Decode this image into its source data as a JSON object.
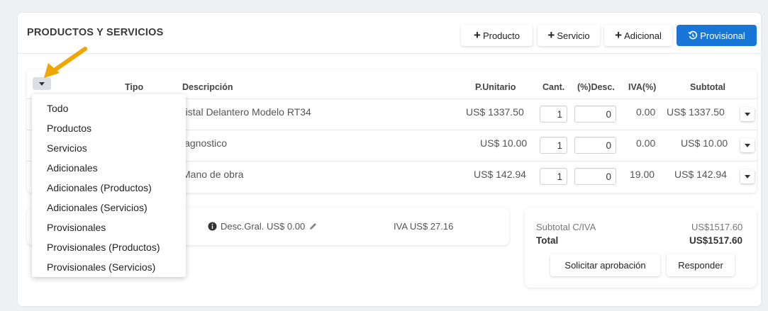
{
  "header": {
    "title": "PRODUCTOS Y SERVICIOS",
    "buttons": {
      "producto": "Producto",
      "servicio": "Servicio",
      "adicional": "Adicional",
      "provisional": "Provisional"
    }
  },
  "table": {
    "columns": {
      "tipo": "Tipo",
      "descripcion": "Descripción",
      "unitario": "P.Unitario",
      "cant": "Cant.",
      "desc": "(%)Desc.",
      "iva": "IVA(%)",
      "subtotal": "Subtotal"
    },
    "rows": [
      {
        "descripcion": "ristal Delantero Modelo RT34",
        "unitario": "US$ 1337.50",
        "cant": "1",
        "desc": "0",
        "iva": "0.00",
        "subtotal": "US$ 1337.50"
      },
      {
        "descripcion": "iagnostico",
        "unitario": "US$ 10.00",
        "cant": "1",
        "desc": "0",
        "iva": "0.00",
        "subtotal": "US$ 10.00"
      },
      {
        "descripcion": "Mano de obra",
        "unitario": "US$ 142.94",
        "cant": "1",
        "desc": "0",
        "iva": "19.00",
        "subtotal": "US$ 142.94"
      }
    ]
  },
  "summary": {
    "desc_general": "Desc.Gral. US$ 0.00",
    "iva": "IVA US$ 27.16"
  },
  "totals": {
    "subtotal_label": "Subtotal C/IVA",
    "subtotal_value": "US$1517.60",
    "total_label": "Total",
    "total_value": "US$1517.60",
    "solicitar": "Solicitar aprobación",
    "responder": "Responder"
  },
  "filter_menu": {
    "items": [
      "Todo",
      "Productos",
      "Servicios",
      "Adicionales",
      "Adicionales (Productos)",
      "Adicionales (Servicios)",
      "Provisionales",
      "Provisionales (Productos)",
      "Provisionales (Servicios)"
    ]
  },
  "colors": {
    "primary": "#1877d6",
    "annotation_arrow": "#f0a500"
  }
}
